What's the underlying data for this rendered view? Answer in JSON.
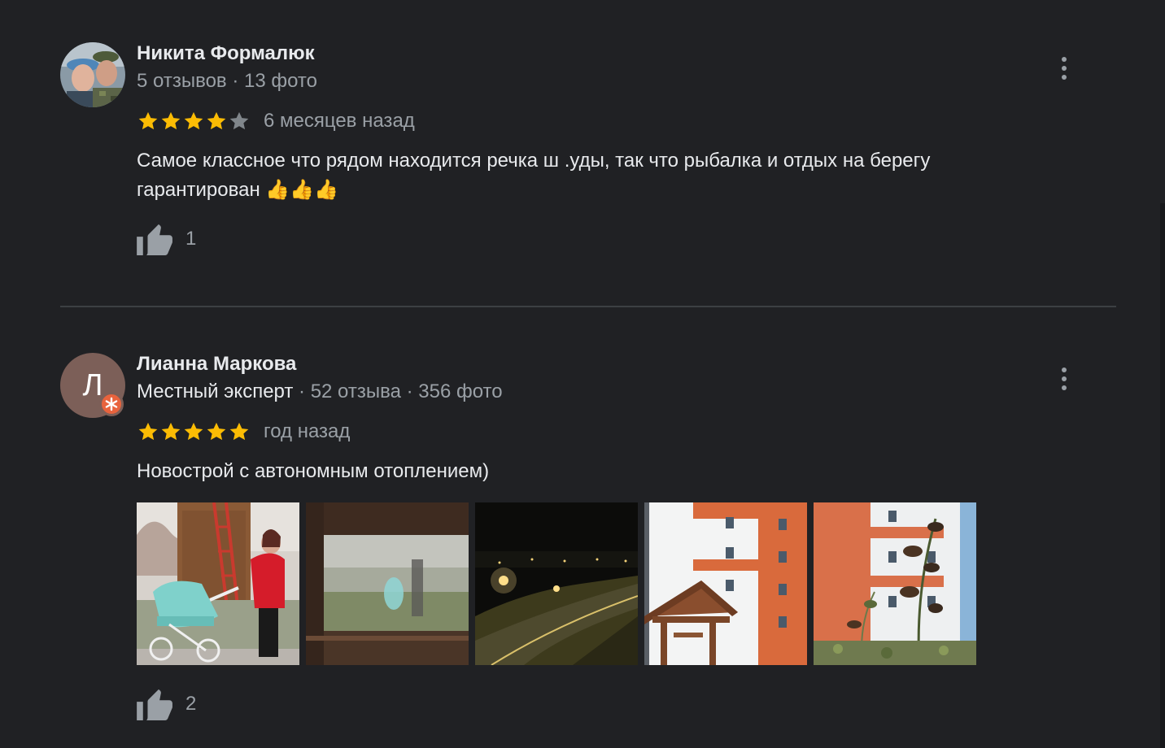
{
  "reviews": [
    {
      "author": "Никита Формалюк",
      "meta": "5 отзывов · 13 фото",
      "rating": 4,
      "date": "6 месяцев назад",
      "text": "Самое классное что рядом находится речка ш .уды, так что рыбалка и отдых на берегу гарантирован 👍👍👍",
      "likes": "1"
    },
    {
      "author": "Лианна Маркова",
      "avatar_letter": "Л",
      "local_guide": "Местный эксперт",
      "meta": " · 52 отзыва · 356 фото",
      "rating": 5,
      "date": "год назад",
      "text": "Новострой с автономным отоплением)",
      "photos": [
        "photo-stroller-tower",
        "photo-through-fence",
        "photo-night-road",
        "photo-building-gazebo",
        "photo-building-plants"
      ],
      "likes": "2"
    }
  ],
  "colors": {
    "background": "#202124",
    "star": "#fbbc04",
    "star_empty": "#80868b",
    "secondary_text": "#9aa0a6",
    "badge": "#e8633d"
  }
}
